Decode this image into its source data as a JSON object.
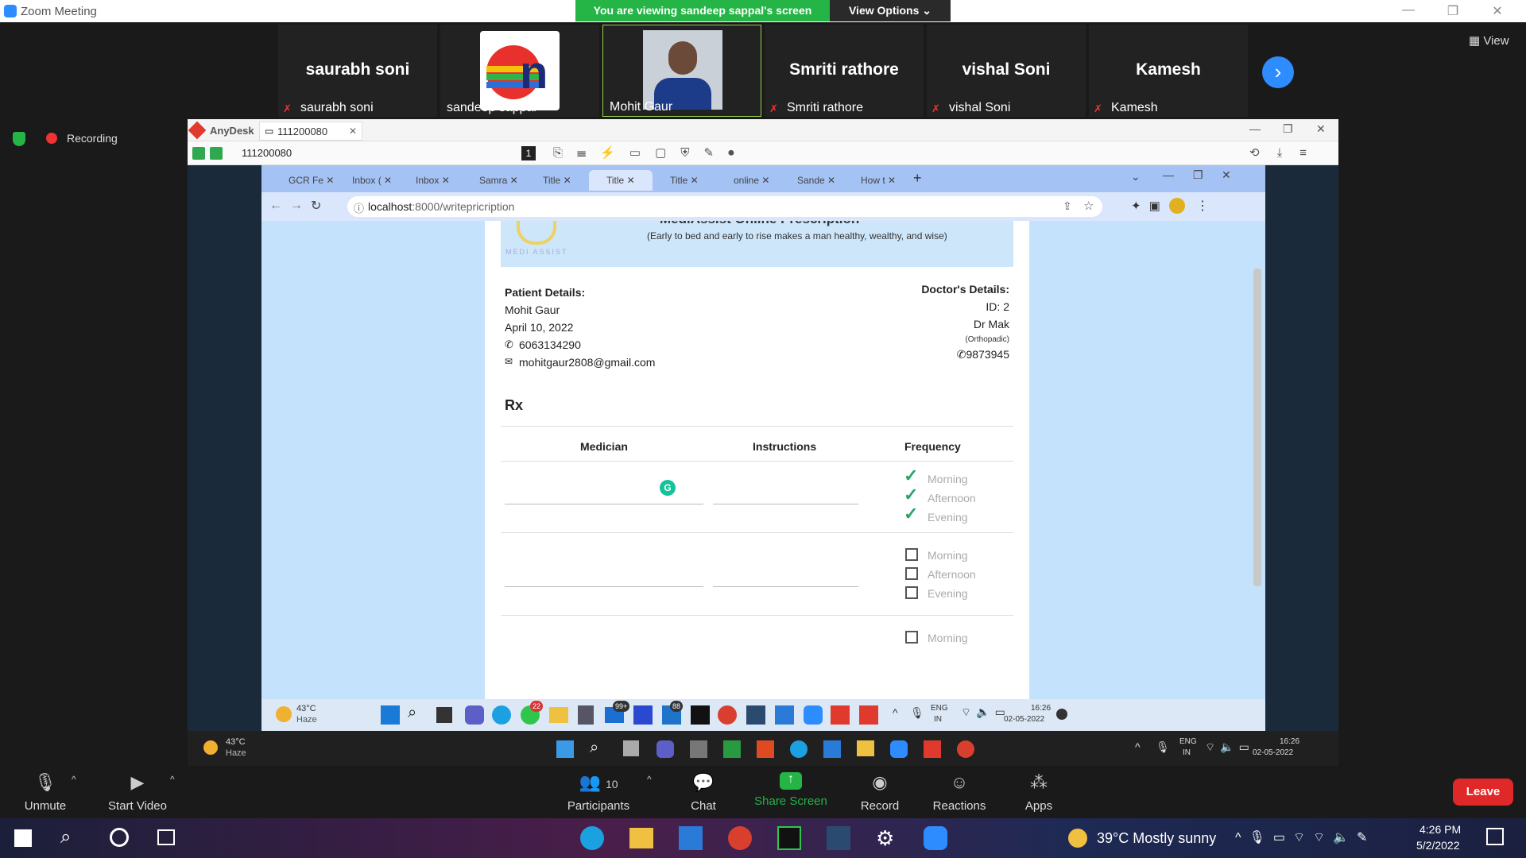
{
  "zoom": {
    "title": "Zoom Meeting",
    "share_banner": "You are viewing sandeep sappal's screen",
    "view_options": "View Options",
    "view_label": "View",
    "recording": "Recording",
    "participants": [
      {
        "name": "saurabh soni",
        "label": "saurabh soni"
      },
      {
        "name": "",
        "label": "sandeep sappal"
      },
      {
        "name": "",
        "label": "Mohit Gaur"
      },
      {
        "name": "Smriti rathore",
        "label": "Smriti rathore"
      },
      {
        "name": "vishal Soni",
        "label": "vishal Soni"
      },
      {
        "name": "Kamesh",
        "label": "Kamesh"
      }
    ],
    "toolbar": {
      "unmute": "Unmute",
      "start_video": "Start Video",
      "participants": "Participants",
      "participants_count": "10",
      "chat": "Chat",
      "share_screen": "Share Screen",
      "record": "Record",
      "reactions": "Reactions",
      "apps": "Apps",
      "leave": "Leave"
    }
  },
  "anydesk": {
    "brand": "AnyDesk",
    "tab_id": "111200080",
    "address": "111200080",
    "toolbar_num": "1"
  },
  "chrome": {
    "tabs": [
      "GCR Fe",
      "Inbox (",
      "Inbox",
      "Samra",
      "Title",
      "Title",
      "Title",
      "online",
      "Sande",
      "How t"
    ],
    "url_host": "localhost",
    "url_path": ":8000/writepricription"
  },
  "page": {
    "header_title": "MediAssist Online Prescription",
    "tagline": "(Early to bed and early to rise makes a man healthy, wealthy, and wise)",
    "logo_text": "MEDI ASSIST",
    "patient": {
      "heading": "Patient Details:",
      "name": "Mohit Gaur",
      "date": "April 10, 2022",
      "phone": "6063134290",
      "email": "mohitgaur2808@gmail.com"
    },
    "doctor": {
      "heading": "Doctor's Details:",
      "id": "ID: 2",
      "name": "Dr Mak",
      "speciality": "(Orthopadic)",
      "phone": "9873945"
    },
    "rx": "Rx",
    "columns": [
      "Medician",
      "Instructions",
      "Frequency"
    ],
    "frequency_options": [
      "Morning",
      "Afternoon",
      "Evening"
    ]
  },
  "remote_taskbar": {
    "weather_temp": "43°C",
    "weather_desc": "Haze",
    "lang1": "ENG",
    "lang2": "IN",
    "time": "16:26",
    "date": "02-05-2022",
    "badge1": "22",
    "badge2": "99+",
    "badge3": "88"
  },
  "host_taskbar": {
    "weather": "39°C  Mostly sunny",
    "time": "4:26 PM",
    "date": "5/2/2022"
  },
  "colors": {
    "zoom_green": "#25b446",
    "zoom_blue": "#2d8cff",
    "leave_red": "#e02828",
    "page_bg": "#c4e2fb",
    "tick_green": "#2aa36a"
  }
}
